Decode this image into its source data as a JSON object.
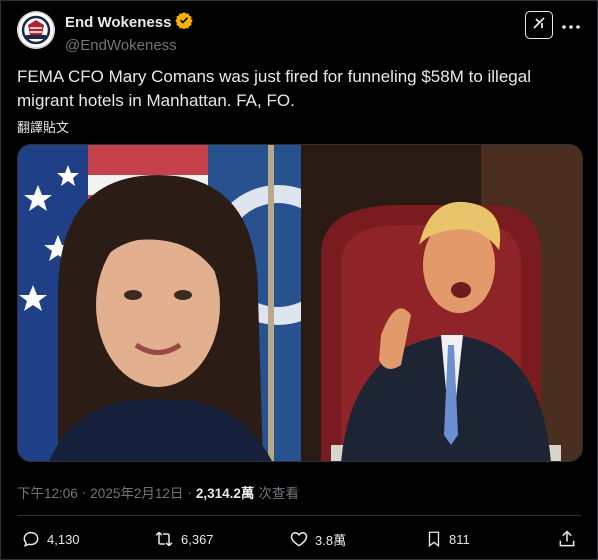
{
  "post": {
    "author": {
      "display_name": "End Wokeness",
      "handle": "@EndWokeness",
      "verified": true,
      "avatar_text": "END WOKENESS"
    },
    "text_line1": "FEMA CFO Mary Comans was just fired for funneling $58M to illegal",
    "text_line2": "migrant hotels in Manhattan. FA, FO.",
    "translate_label": "翻譯貼文",
    "meta": {
      "time": "下午12:06",
      "sep1": "·",
      "date": "2025年2月12日",
      "sep2": "·",
      "views": "2,314.2萬",
      "views_label": "次查看"
    },
    "actions": {
      "replies": "4,130",
      "reposts": "6,367",
      "likes": "3.8萬",
      "bookmarks": "811"
    }
  },
  "colors": {
    "background": "#000000",
    "text": "#e7e9ea",
    "muted": "#71767b",
    "verified": "#f4b400",
    "border": "#2f3336"
  },
  "icons": [
    "verified-badge-icon",
    "grok-icon",
    "more-icon",
    "reply-icon",
    "repost-icon",
    "like-icon",
    "bookmark-icon",
    "share-icon"
  ]
}
